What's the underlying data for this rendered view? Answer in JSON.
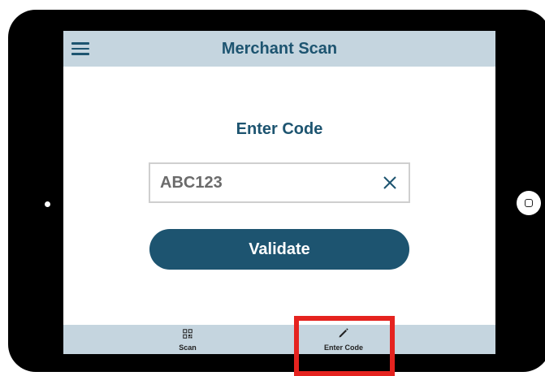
{
  "app_bar": {
    "title": "Merchant Scan",
    "menu_icon": "hamburger-menu-icon"
  },
  "content": {
    "section_title": "Enter Code",
    "code_input": {
      "value": "ABC123",
      "clear_icon": "close-icon"
    },
    "validate_label": "Validate"
  },
  "bottom_nav": {
    "items": [
      {
        "label": "Scan",
        "icon": "qr-code-icon"
      },
      {
        "label": "Enter Code",
        "icon": "pencil-icon"
      }
    ]
  },
  "colors": {
    "primary": "#1d5470",
    "bar_background": "#c5d5df",
    "highlight": "#e5231f",
    "device_frame": "#000000"
  }
}
